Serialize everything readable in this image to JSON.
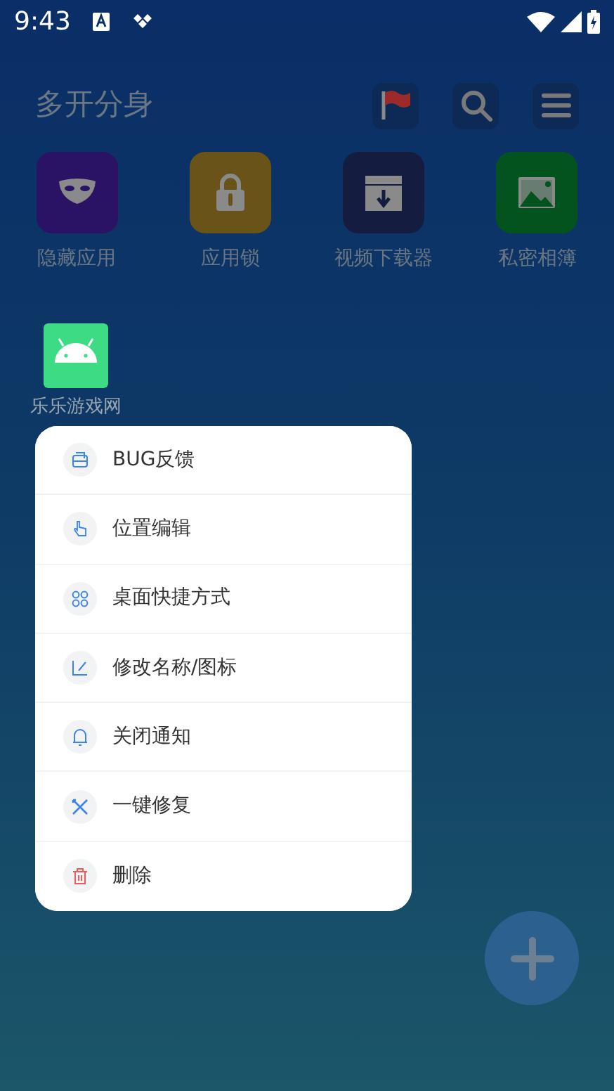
{
  "status_bar": {
    "time": "9:43"
  },
  "header": {
    "title": "多开分身"
  },
  "tools": [
    {
      "kind": "flag"
    },
    {
      "kind": "search"
    },
    {
      "kind": "menu"
    }
  ],
  "apps": [
    {
      "label": "隐藏应用",
      "color": "#2a1265",
      "kind": "mask"
    },
    {
      "label": "应用锁",
      "color": "#6a5319",
      "kind": "lock"
    },
    {
      "label": "视频下载器",
      "color": "#141c3f",
      "kind": "video"
    },
    {
      "label": "私密相簿",
      "color": "#03531f",
      "kind": "photo"
    }
  ],
  "cloned_apps": [
    {
      "label": "乐乐游戏网",
      "selected": true
    }
  ],
  "menu": [
    {
      "label": "BUG反馈",
      "kind": "normal"
    },
    {
      "label": "位置编辑",
      "kind": "normal"
    },
    {
      "label": "桌面快捷方式",
      "kind": "normal"
    },
    {
      "label": "修改名称/图标",
      "kind": "normal"
    },
    {
      "label": "关闭通知",
      "kind": "normal"
    },
    {
      "label": "一键修复",
      "kind": "normal"
    },
    {
      "label": "删除",
      "kind": "danger"
    }
  ]
}
